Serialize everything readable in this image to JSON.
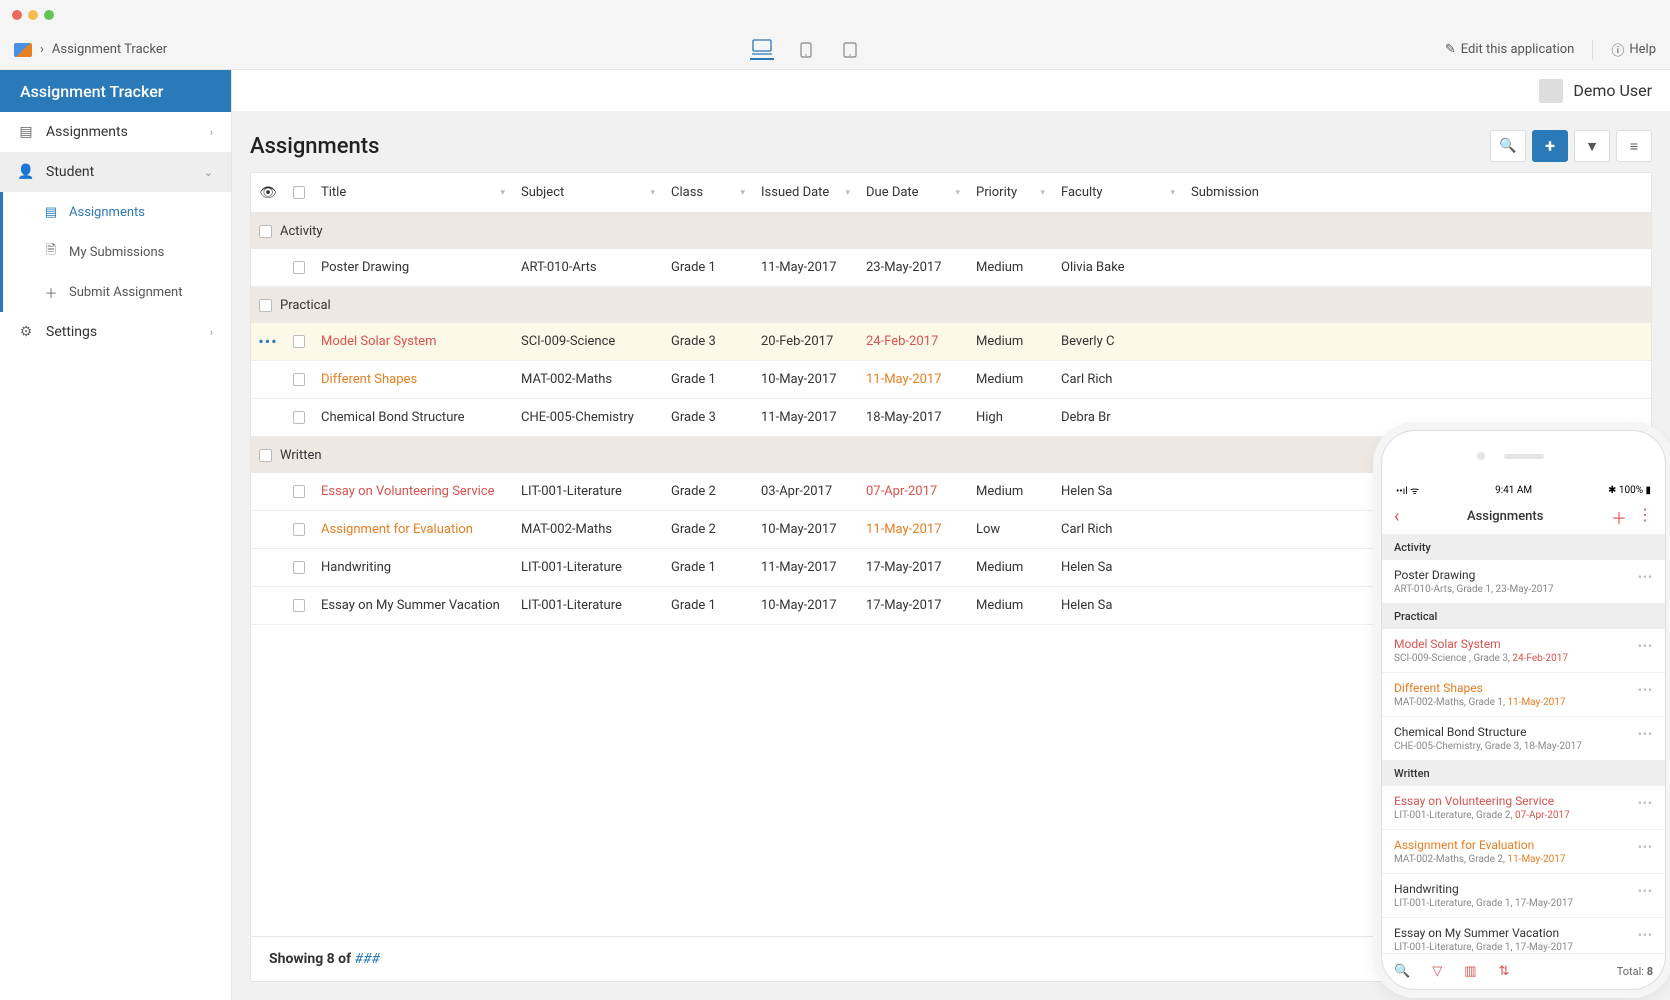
{
  "breadcrumb": {
    "app": "Assignment Tracker"
  },
  "topbar": {
    "edit": "Edit this application",
    "help": "Help"
  },
  "user": {
    "name": "Demo User"
  },
  "sidebar": {
    "title": "Assignment Tracker",
    "items": [
      {
        "label": "Assignments"
      },
      {
        "label": "Student"
      },
      {
        "label": "Settings"
      }
    ],
    "sub": [
      {
        "label": "Assignments"
      },
      {
        "label": "My Submissions"
      },
      {
        "label": "Submit Assignment"
      }
    ]
  },
  "page": {
    "title": "Assignments"
  },
  "columns": {
    "title": "Title",
    "subject": "Subject",
    "class": "Class",
    "issued": "Issued Date",
    "due": "Due Date",
    "priority": "Priority",
    "faculty": "Faculty",
    "submission": "Submission"
  },
  "groups": {
    "g0": "Activity",
    "g1": "Practical",
    "g2": "Written"
  },
  "rows": {
    "r0": {
      "title": "Poster Drawing",
      "subject": "ART-010-Arts",
      "class": "Grade 1",
      "issued": "11-May-2017",
      "due": "23-May-2017",
      "priority": "Medium",
      "faculty": "Olivia Bake"
    },
    "r1": {
      "title": "Model Solar System",
      "subject": "SCI-009-Science",
      "class": "Grade 3",
      "issued": "20-Feb-2017",
      "due": "24-Feb-2017",
      "priority": "Medium",
      "faculty": "Beverly C"
    },
    "r2": {
      "title": "Different Shapes",
      "subject": "MAT-002-Maths",
      "class": "Grade 1",
      "issued": "10-May-2017",
      "due": "11-May-2017",
      "priority": "Medium",
      "faculty": "Carl Rich"
    },
    "r3": {
      "title": "Chemical Bond Structure",
      "subject": "CHE-005-Chemistry",
      "class": "Grade 3",
      "issued": "11-May-2017",
      "due": "18-May-2017",
      "priority": "High",
      "faculty": "Debra Br"
    },
    "r4": {
      "title": "Essay on Volunteering Service",
      "subject": "LIT-001-Literature",
      "class": "Grade 2",
      "issued": "03-Apr-2017",
      "due": "07-Apr-2017",
      "priority": "Medium",
      "faculty": "Helen Sa"
    },
    "r5": {
      "title": "Assignment for Evaluation",
      "subject": "MAT-002-Maths",
      "class": "Grade 2",
      "issued": "10-May-2017",
      "due": "11-May-2017",
      "priority": "Low",
      "faculty": "Carl Rich"
    },
    "r6": {
      "title": "Handwriting",
      "subject": "LIT-001-Literature",
      "class": "Grade 1",
      "issued": "11-May-2017",
      "due": "17-May-2017",
      "priority": "Medium",
      "faculty": "Helen Sa"
    },
    "r7": {
      "title": "Essay on My Summer Vacation",
      "subject": "LIT-001-Literature",
      "class": "Grade 1",
      "issued": "10-May-2017",
      "due": "17-May-2017",
      "priority": "Medium",
      "faculty": "Helen Sa"
    }
  },
  "footer": {
    "showing": "Showing 8 of ",
    "hash": "###"
  },
  "phone": {
    "status": {
      "left": "📶 📡",
      "time": "9:41 AM",
      "right": "✱ 100% ▮"
    },
    "title": "Assignments",
    "groups": {
      "g0": "Activity",
      "g1": "Practical",
      "g2": "Written"
    },
    "items": {
      "i0": {
        "t": "Poster Drawing",
        "s": "ART-010-Arts, Grade 1, 23-May-2017"
      },
      "i1": {
        "t": "Model Solar System",
        "s1": "SCI-009-Science , Grade 3,  ",
        "d": "24-Feb-2017"
      },
      "i2": {
        "t": "Different Shapes",
        "s1": "MAT-002-Maths, Grade 1,  ",
        "d": "11-May-2017"
      },
      "i3": {
        "t": "Chemical Bond Structure",
        "s": "CHE-005-Chemistry, Grade 3, 18-May-2017"
      },
      "i4": {
        "t": "Essay on Volunteering Service",
        "s1": "LIT-001-Literature, Grade 2,  ",
        "d": "07-Apr-2017"
      },
      "i5": {
        "t": "Assignment for Evaluation",
        "s1": "MAT-002-Maths, Grade 2,  ",
        "d": "11-May-2017"
      },
      "i6": {
        "t": "Handwriting",
        "s": "LIT-001-Literature, Grade 1, 17-May-2017"
      },
      "i7": {
        "t": "Essay on My Summer Vacation",
        "s": "LIT-001-Literature, Grade 1, 17-May-2017"
      }
    },
    "footer": {
      "total_label": "Total: ",
      "total": "8"
    }
  }
}
